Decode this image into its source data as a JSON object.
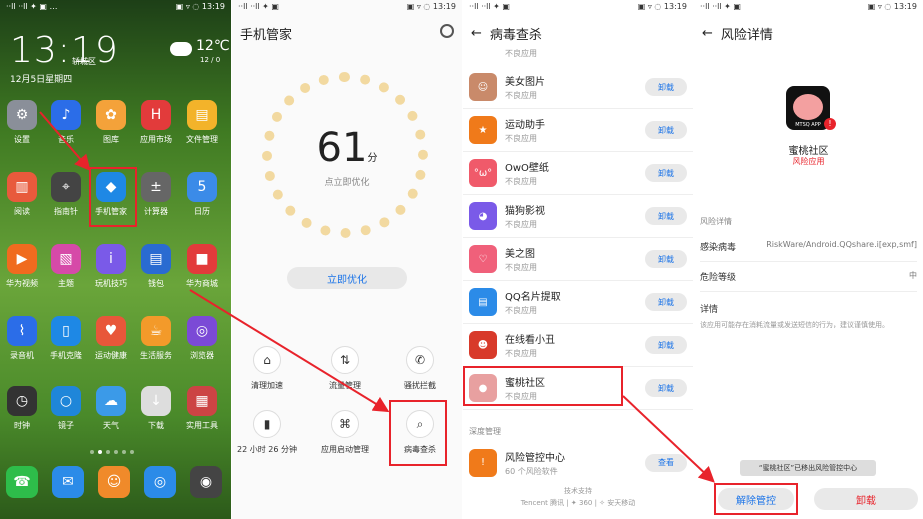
{
  "p1": {
    "status_left": "··ll ··ll ✦ ▣ …",
    "status_right": "▣ ▿ ◌ 13:19",
    "clock": "13:19",
    "location": "轿城区",
    "date": "12月5日星期四",
    "temp": "12℃",
    "temp_range": "12 / 0",
    "apps": [
      {
        "label": "设置",
        "color": "#8a8f99",
        "glyph": "⚙"
      },
      {
        "label": "音乐",
        "color": "#2b6de8",
        "glyph": "♪"
      },
      {
        "label": "图库",
        "color": "#f4a23a",
        "glyph": "✿"
      },
      {
        "label": "应用市场",
        "color": "#e23b3b",
        "glyph": "H"
      },
      {
        "label": "文件管理",
        "color": "#f3b32a",
        "glyph": "▤"
      },
      {
        "label": "阅读",
        "color": "#e85a3c",
        "glyph": "▥"
      },
      {
        "label": "指南针",
        "color": "#444",
        "glyph": "⌖"
      },
      {
        "label": "手机管家",
        "color": "#1e88e5",
        "glyph": "◆"
      },
      {
        "label": "计算器",
        "color": "#666",
        "glyph": "±"
      },
      {
        "label": "日历",
        "color": "#3b8be8",
        "glyph": "5"
      },
      {
        "label": "华为视频",
        "color": "#f06b1f",
        "glyph": "▶"
      },
      {
        "label": "主题",
        "color": "#d64aa8",
        "glyph": "▧"
      },
      {
        "label": "玩机技巧",
        "color": "#7a5ae8",
        "glyph": "i"
      },
      {
        "label": "钱包",
        "color": "#2a6bd1",
        "glyph": "▤"
      },
      {
        "label": "华为商城",
        "color": "#e23b3b",
        "glyph": "■"
      },
      {
        "label": "录音机",
        "color": "#2b6de8",
        "glyph": "⌇"
      },
      {
        "label": "手机克隆",
        "color": "#1e88e5",
        "glyph": "▯"
      },
      {
        "label": "运动健康",
        "color": "#e8573a",
        "glyph": "♥"
      },
      {
        "label": "生活服务",
        "color": "#f39a2a",
        "glyph": "☕"
      },
      {
        "label": "浏览器",
        "color": "#7b4ad6",
        "glyph": "◎"
      },
      {
        "label": "时钟",
        "color": "#333",
        "glyph": "◷"
      },
      {
        "label": "镜子",
        "color": "#1f86d9",
        "glyph": "○"
      },
      {
        "label": "天气",
        "color": "#3b9ae8",
        "glyph": "☁"
      },
      {
        "label": "下载",
        "color": "#ddd",
        "glyph": "↓"
      },
      {
        "label": "实用工具",
        "color": "#c44",
        "glyph": "▦"
      }
    ],
    "dock": [
      {
        "color": "#2ebd4a",
        "glyph": "☎"
      },
      {
        "color": "#2b8be8",
        "glyph": "✉"
      },
      {
        "color": "#f08a2a",
        "glyph": "☺"
      },
      {
        "color": "#2b8be8",
        "glyph": "◎"
      },
      {
        "color": "#444",
        "glyph": "◉"
      }
    ]
  },
  "p2": {
    "status_left": "··ll ··ll ✦ ▣",
    "status_right": "▣ ▿ ◌ 13:19",
    "title": "手机管家",
    "score": "61",
    "score_unit": "分",
    "subtitle": "点立即优化",
    "optimize": "立即优化",
    "tools": [
      {
        "label": "清理加速",
        "glyph": "⌂"
      },
      {
        "label": "流量管理",
        "glyph": "⇅"
      },
      {
        "label": "骚扰拦截",
        "glyph": "✆"
      },
      {
        "label": "22 小时 26 分钟",
        "glyph": "▮"
      },
      {
        "label": "应用启动管理",
        "glyph": "⌘"
      },
      {
        "label": "病毒查杀",
        "glyph": "⌕"
      }
    ]
  },
  "p3": {
    "status_left": "··ll ··ll ✦ ▣",
    "status_right": "▣ ▿ ◌ 13:19",
    "back": "←",
    "title": "病毒查杀",
    "top_desc": "不良应用",
    "uninstall": "卸载",
    "apps": [
      {
        "name": "美女图片",
        "desc": "不良应用",
        "color": "#c98a6a",
        "glyph": "☺"
      },
      {
        "name": "运动助手",
        "desc": "不良应用",
        "color": "#f07a1a",
        "glyph": "★"
      },
      {
        "name": "OwO壁纸",
        "desc": "不良应用",
        "color": "#f05a6a",
        "glyph": "°ω°"
      },
      {
        "name": "猫狗影视",
        "desc": "不良应用",
        "color": "#7a5ae8",
        "glyph": "◕"
      },
      {
        "name": "美之图",
        "desc": "不良应用",
        "color": "#f0607a",
        "glyph": "♡"
      },
      {
        "name": "QQ名片提取",
        "desc": "不良应用",
        "color": "#2b8be8",
        "glyph": "▤"
      },
      {
        "name": "在线看小丑",
        "desc": "不良应用",
        "color": "#d83a2a",
        "glyph": "☻"
      },
      {
        "name": "蜜桃社区",
        "desc": "不良应用",
        "color": "#e8a0a0",
        "glyph": "●"
      }
    ],
    "section": "深度管理",
    "risk_center": "风险管控中心",
    "risk_count": "60 个风险软件",
    "view": "查看",
    "tech_support": "技术支持",
    "tech_brands": "Tencent 腾讯 | ✦ 360 | ✧ 安天移动"
  },
  "p4": {
    "status_left": "··ll ··ll ✦ ▣",
    "status_right": "▣ ▿ ◌ 13:19",
    "back": "←",
    "title": "风险详情",
    "app_name": "蜜桃社区",
    "app_tag": "风险应用",
    "logo_text": "MTSQ APP",
    "section": "风险详情",
    "virus_label": "感染病毒",
    "virus_value": "RiskWare/Android.QQshare.i[exp,smf]",
    "level_label": "危险等级",
    "level_value": "中",
    "detail_label": "详情",
    "detail_text": "该应用可能存在消耗流量或发送短信的行为，建议谨慎使用。",
    "toast": "“蜜桃社区”已移出风险管控中心",
    "release": "解除管控",
    "uninstall": "卸载"
  },
  "colors": {
    "highlight": "#e8232b",
    "link": "#1a73e8",
    "danger": "#e8232b"
  }
}
